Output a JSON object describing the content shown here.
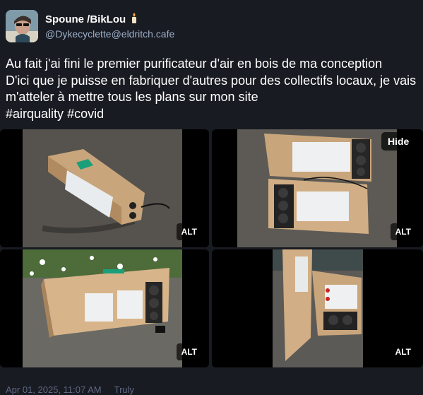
{
  "author": {
    "display_name": "Spoune /BikLou",
    "handle": "@Dykecyclette@eldritch.cafe"
  },
  "post": {
    "paragraph1": "Au fait j'ai fini le premier purificateur d'air en bois de ma conception",
    "paragraph2": "D'ici que je puisse en fabriquer d'autres pour des collectifs locaux, je vais m'atteler à mettre tous les plans sur mon site",
    "hashtags": [
      "#airquality",
      "#covid"
    ]
  },
  "media": {
    "hide_label": "Hide",
    "alt_label": "ALT"
  },
  "footer": {
    "timestamp": "Apr 01, 2025, 11:07 AM",
    "reply_label": "Truly"
  }
}
